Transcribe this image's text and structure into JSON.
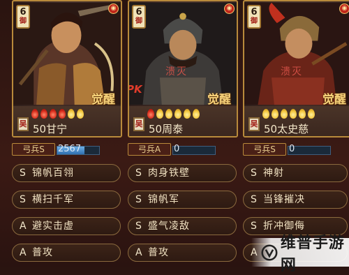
{
  "cards": [
    {
      "level": "6",
      "level_tag": "御",
      "status": "",
      "pk": "",
      "awaken": "觉醒",
      "faction": "吴",
      "flames": [
        "red",
        "red",
        "red",
        "red",
        "gold",
        "gold"
      ],
      "name": "50甘宁",
      "unit": "弓兵S",
      "troops": "2567",
      "troops_fill": 0.65,
      "skills": [
        {
          "lv": "S",
          "name": "锦帆百翎"
        },
        {
          "lv": "S",
          "name": "横扫千军"
        },
        {
          "lv": "A",
          "name": "避实击虚"
        },
        {
          "lv": "A",
          "name": "普攻"
        }
      ]
    },
    {
      "level": "6",
      "level_tag": "御",
      "status": "溃灭",
      "pk": "PK",
      "awaken": "觉醒",
      "faction": "吴",
      "flames": [
        "red",
        "gold",
        "gold",
        "gold",
        "gold",
        "gold"
      ],
      "name": "50周泰",
      "unit": "弓兵A",
      "troops": "0",
      "troops_fill": 0,
      "skills": [
        {
          "lv": "S",
          "name": "肉身铁壁"
        },
        {
          "lv": "S",
          "name": "锦帆军"
        },
        {
          "lv": "S",
          "name": "盛气凌敌"
        },
        {
          "lv": "A",
          "name": "普攻"
        }
      ]
    },
    {
      "level": "6",
      "level_tag": "御",
      "status": "溃灭",
      "pk": "",
      "awaken": "觉醒",
      "faction": "吴",
      "flames": [
        "gold",
        "gold",
        "gold",
        "gold",
        "gold",
        "gold"
      ],
      "name": "50太史慈",
      "unit": "弓兵S",
      "troops": "0",
      "troops_fill": 0,
      "skills": [
        {
          "lv": "S",
          "name": "神射"
        },
        {
          "lv": "S",
          "name": "当锋摧决"
        },
        {
          "lv": "S",
          "name": "折冲御侮"
        },
        {
          "lv": "A",
          "name": ""
        }
      ]
    }
  ],
  "watermark": "维普手游网"
}
